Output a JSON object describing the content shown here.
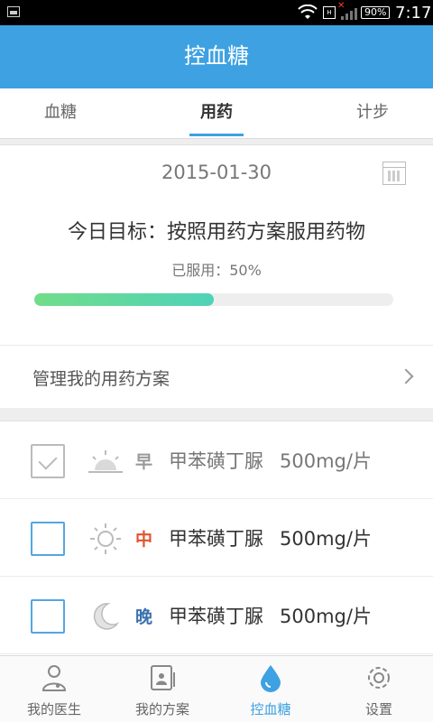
{
  "status_bar": {
    "time": "7:17",
    "battery": "90%",
    "icons": [
      "image-icon",
      "wifi-icon",
      "sim-icon",
      "signal-icon",
      "battery-icon"
    ]
  },
  "app_bar": {
    "title": "控血糖"
  },
  "tabs": [
    {
      "label": "血糖",
      "active": false
    },
    {
      "label": "用药",
      "active": true
    },
    {
      "label": "计步",
      "active": false
    }
  ],
  "goal": {
    "date": "2015-01-30",
    "title": "今日目标：按照用药方案服用药物",
    "taken_label": "已服用：50%",
    "progress_fraction": 0.5
  },
  "manage": {
    "label": "管理我的用药方案"
  },
  "medications": [
    {
      "period": "早",
      "icon": "sunrise-icon",
      "drug": "甲苯磺丁脲",
      "dose": "500mg/片",
      "checked": true,
      "period_color": "#999999"
    },
    {
      "period": "中",
      "icon": "sun-icon",
      "drug": "甲苯磺丁脲",
      "dose": "500mg/片",
      "checked": false,
      "period_color": "#e2532f"
    },
    {
      "period": "晚",
      "icon": "moon-icon",
      "drug": "甲苯磺丁脲",
      "dose": "500mg/片",
      "checked": false,
      "period_color": "#3a72b0"
    }
  ],
  "bottom_nav": [
    {
      "label": "我的医生",
      "icon": "doctor-icon",
      "active": false
    },
    {
      "label": "我的方案",
      "icon": "plan-icon",
      "active": false
    },
    {
      "label": "控血糖",
      "icon": "blood-drop-icon",
      "active": true
    },
    {
      "label": "设置",
      "icon": "gear-icon",
      "active": false
    }
  ],
  "colors": {
    "primary": "#3da1e2",
    "progress_start": "#71dd8a",
    "progress_end": "#4fd2b8",
    "checkbox_border": "#54a6e2"
  }
}
